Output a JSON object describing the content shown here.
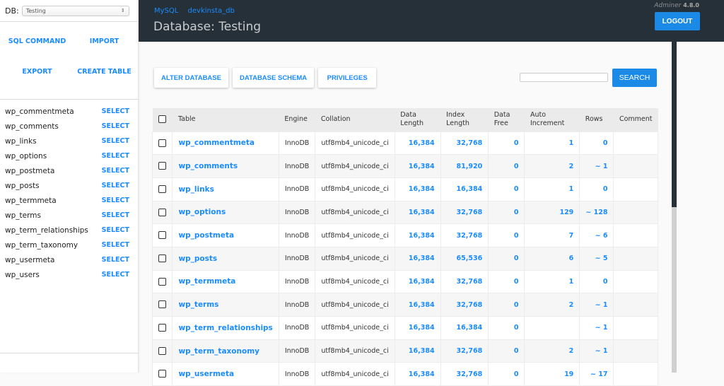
{
  "sidebar": {
    "db_label": "DB:",
    "db_selected": "Testing",
    "links": [
      "SQL COMMAND",
      "IMPORT",
      "EXPORT",
      "CREATE TABLE"
    ],
    "select_label": "SELECT",
    "tables": [
      "wp_commentmeta",
      "wp_comments",
      "wp_links",
      "wp_options",
      "wp_postmeta",
      "wp_posts",
      "wp_termmeta",
      "wp_terms",
      "wp_term_relationships",
      "wp_term_taxonomy",
      "wp_usermeta",
      "wp_users"
    ]
  },
  "header": {
    "breadcrumb": [
      "MySQL",
      "devkinsta_db"
    ],
    "title": "Database: Testing",
    "app_name": "Adminer",
    "version": "4.8.0",
    "logout_label": "LOGOUT"
  },
  "actions": {
    "buttons": [
      "ALTER DATABASE",
      "DATABASE SCHEMA",
      "PRIVILEGES"
    ],
    "search_value": "",
    "search_label": "SEARCH"
  },
  "table": {
    "headers": [
      "Table",
      "Engine",
      "Collation",
      "Data Length",
      "Index Length",
      "Data Free",
      "Auto Increment",
      "Rows",
      "Comment"
    ],
    "rows": [
      {
        "name": "wp_commentmeta",
        "engine": "InnoDB",
        "collation": "utf8mb4_unicode_ci",
        "data_length": "16,384",
        "index_length": "32,768",
        "data_free": "0",
        "auto_increment": "1",
        "rows": "0",
        "comment": ""
      },
      {
        "name": "wp_comments",
        "engine": "InnoDB",
        "collation": "utf8mb4_unicode_ci",
        "data_length": "16,384",
        "index_length": "81,920",
        "data_free": "0",
        "auto_increment": "2",
        "rows": "~ 1",
        "comment": ""
      },
      {
        "name": "wp_links",
        "engine": "InnoDB",
        "collation": "utf8mb4_unicode_ci",
        "data_length": "16,384",
        "index_length": "16,384",
        "data_free": "0",
        "auto_increment": "1",
        "rows": "0",
        "comment": ""
      },
      {
        "name": "wp_options",
        "engine": "InnoDB",
        "collation": "utf8mb4_unicode_ci",
        "data_length": "16,384",
        "index_length": "32,768",
        "data_free": "0",
        "auto_increment": "129",
        "rows": "~ 128",
        "comment": ""
      },
      {
        "name": "wp_postmeta",
        "engine": "InnoDB",
        "collation": "utf8mb4_unicode_ci",
        "data_length": "16,384",
        "index_length": "32,768",
        "data_free": "0",
        "auto_increment": "7",
        "rows": "~ 6",
        "comment": ""
      },
      {
        "name": "wp_posts",
        "engine": "InnoDB",
        "collation": "utf8mb4_unicode_ci",
        "data_length": "16,384",
        "index_length": "65,536",
        "data_free": "0",
        "auto_increment": "6",
        "rows": "~ 5",
        "comment": ""
      },
      {
        "name": "wp_termmeta",
        "engine": "InnoDB",
        "collation": "utf8mb4_unicode_ci",
        "data_length": "16,384",
        "index_length": "32,768",
        "data_free": "0",
        "auto_increment": "1",
        "rows": "0",
        "comment": ""
      },
      {
        "name": "wp_terms",
        "engine": "InnoDB",
        "collation": "utf8mb4_unicode_ci",
        "data_length": "16,384",
        "index_length": "32,768",
        "data_free": "0",
        "auto_increment": "2",
        "rows": "~ 1",
        "comment": ""
      },
      {
        "name": "wp_term_relationships",
        "engine": "InnoDB",
        "collation": "utf8mb4_unicode_ci",
        "data_length": "16,384",
        "index_length": "16,384",
        "data_free": "0",
        "auto_increment": "",
        "rows": "~ 1",
        "comment": ""
      },
      {
        "name": "wp_term_taxonomy",
        "engine": "InnoDB",
        "collation": "utf8mb4_unicode_ci",
        "data_length": "16,384",
        "index_length": "32,768",
        "data_free": "0",
        "auto_increment": "2",
        "rows": "~ 1",
        "comment": ""
      },
      {
        "name": "wp_usermeta",
        "engine": "InnoDB",
        "collation": "utf8mb4_unicode_ci",
        "data_length": "16,384",
        "index_length": "32,768",
        "data_free": "0",
        "auto_increment": "19",
        "rows": "~ 17",
        "comment": ""
      }
    ]
  },
  "colors": {
    "accent": "#1a8cff",
    "header_bg": "#253038",
    "button_bg": "#1a8ae6"
  }
}
